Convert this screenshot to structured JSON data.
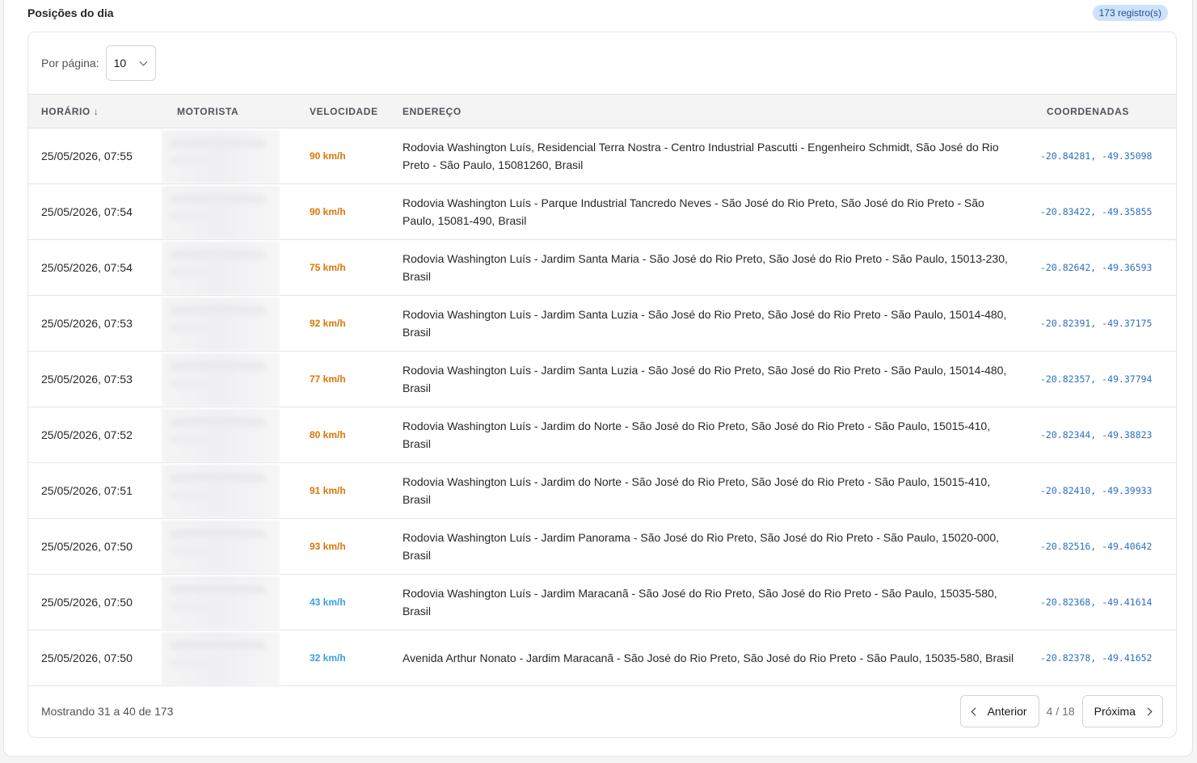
{
  "section": {
    "title": "Posições do dia",
    "badge": "173 registro(s)"
  },
  "per_page": {
    "label": "Por página:",
    "value": "10"
  },
  "table": {
    "headers": {
      "time": "HORÁRIO",
      "sort_icon": "↓",
      "driver": "MOTORISTA",
      "speed": "VELOCIDADE",
      "address": "ENDEREÇO",
      "coords": "COORDENADAS"
    },
    "speed_colors": {
      "high": "#d97706",
      "low": "#38a0e0"
    },
    "rows": [
      {
        "time": "25/05/2026, 07:55",
        "driver": "",
        "speed": "90 km/h",
        "speed_level": "high",
        "address": "Rodovia Washington Luís, Residencial Terra Nostra - Centro Industrial Pascutti - Engenheiro Schmidt, São José do Rio Preto - São Paulo, 15081260, Brasil",
        "coords": "-20.84281, -49.35098"
      },
      {
        "time": "25/05/2026, 07:54",
        "driver": "",
        "speed": "90 km/h",
        "speed_level": "high",
        "address": "Rodovia Washington Luís - Parque Industrial Tancredo Neves - São José do Rio Preto, São José do Rio Preto - São Paulo, 15081-490, Brasil",
        "coords": "-20.83422, -49.35855"
      },
      {
        "time": "25/05/2026, 07:54",
        "driver": "",
        "speed": "75 km/h",
        "speed_level": "high",
        "address": "Rodovia Washington Luís - Jardim Santa Maria - São José do Rio Preto, São José do Rio Preto - São Paulo, 15013-230, Brasil",
        "coords": "-20.82642, -49.36593"
      },
      {
        "time": "25/05/2026, 07:53",
        "driver": "",
        "speed": "92 km/h",
        "speed_level": "high",
        "address": "Rodovia Washington Luís - Jardim Santa Luzia - São José do Rio Preto, São José do Rio Preto - São Paulo, 15014-480, Brasil",
        "coords": "-20.82391, -49.37175"
      },
      {
        "time": "25/05/2026, 07:53",
        "driver": "",
        "speed": "77 km/h",
        "speed_level": "high",
        "address": "Rodovia Washington Luís - Jardim Santa Luzia - São José do Rio Preto, São José do Rio Preto - São Paulo, 15014-480, Brasil",
        "coords": "-20.82357, -49.37794"
      },
      {
        "time": "25/05/2026, 07:52",
        "driver": "",
        "speed": "80 km/h",
        "speed_level": "high",
        "address": "Rodovia Washington Luís - Jardim do Norte - São José do Rio Preto, São José do Rio Preto - São Paulo, 15015-410, Brasil",
        "coords": "-20.82344, -49.38823"
      },
      {
        "time": "25/05/2026, 07:51",
        "driver": "",
        "speed": "91 km/h",
        "speed_level": "high",
        "address": "Rodovia Washington Luís - Jardim do Norte - São José do Rio Preto, São José do Rio Preto - São Paulo, 15015-410, Brasil",
        "coords": "-20.82410, -49.39933"
      },
      {
        "time": "25/05/2026, 07:50",
        "driver": "",
        "speed": "93 km/h",
        "speed_level": "high",
        "address": "Rodovia Washington Luís - Jardim Panorama - São José do Rio Preto, São José do Rio Preto - São Paulo, 15020-000, Brasil",
        "coords": "-20.82516, -49.40642"
      },
      {
        "time": "25/05/2026, 07:50",
        "driver": "",
        "speed": "43 km/h",
        "speed_level": "low",
        "address": "Rodovia Washington Luís - Jardim Maracanã - São José do Rio Preto, São José do Rio Preto - São Paulo, 15035-580, Brasil",
        "coords": "-20.82368, -49.41614"
      },
      {
        "time": "25/05/2026, 07:50",
        "driver": "",
        "speed": "32 km/h",
        "speed_level": "low",
        "address": "Avenida Arthur Nonato - Jardim Maracanã - São José do Rio Preto, São José do Rio Preto - São Paulo, 15035-580, Brasil",
        "coords": "-20.82378, -49.41652"
      }
    ]
  },
  "footer": {
    "showing": "Mostrando 31 a 40 de 173",
    "prev_label": "Anterior",
    "page_indicator": "4 / 18",
    "next_label": "Próxima"
  }
}
